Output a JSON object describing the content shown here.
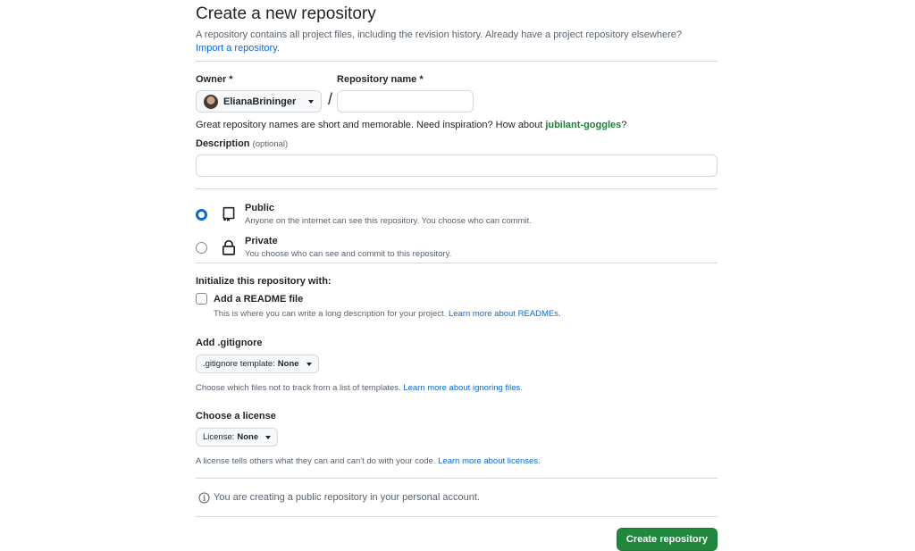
{
  "header": {
    "title": "Create a new repository",
    "subtitle": "A repository contains all project files, including the revision history. Already have a project repository elsewhere?",
    "import_link": "Import a repository."
  },
  "owner": {
    "label": "Owner *",
    "value": "ElianaBrininger"
  },
  "repo_name": {
    "label": "Repository name *",
    "value": "",
    "placeholder": ""
  },
  "separator": "/",
  "hint": {
    "text": "Great repository names are short and memorable. Need inspiration? How about ",
    "suggestion": "jubilant-goggles",
    "suffix": "?"
  },
  "description": {
    "label": "Description",
    "optional": "(optional)",
    "value": ""
  },
  "visibility": {
    "selected": "public",
    "options": [
      {
        "id": "public",
        "title": "Public",
        "desc": "Anyone on the internet can see this repository. You choose who can commit.",
        "icon": "repo-icon"
      },
      {
        "id": "private",
        "title": "Private",
        "desc": "You choose who can see and commit to this repository.",
        "icon": "lock-icon"
      }
    ]
  },
  "init": {
    "label": "Initialize this repository with:",
    "readme_label": "Add a README file",
    "readme_checked": false,
    "readme_note": "This is where you can write a long description for your project. ",
    "readme_link": "Learn more about READMEs."
  },
  "gitignore": {
    "label": "Add .gitignore",
    "select_prefix": ".gitignore template:",
    "select_value": "None",
    "note": "Choose which files not to track from a list of templates. ",
    "link": "Learn more about ignoring files."
  },
  "license": {
    "label": "Choose a license",
    "select_prefix": "License:",
    "select_value": "None",
    "note": "A license tells others what they can and can't do with your code. ",
    "link": "Learn more about licenses."
  },
  "info": {
    "icon": "info-icon",
    "text": "You are creating a public repository in your personal account."
  },
  "actions": {
    "create_label": "Create repository"
  },
  "colors": {
    "accent": "#0969da",
    "primary_button": "#1f883d",
    "suggestion": "#1a7f37"
  }
}
